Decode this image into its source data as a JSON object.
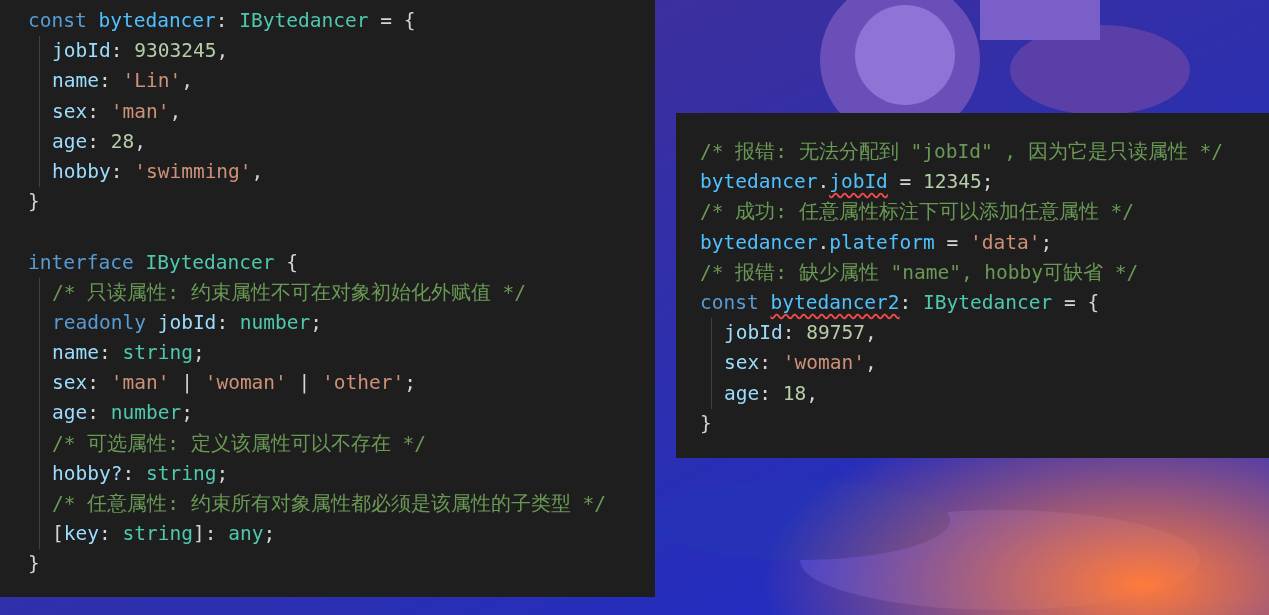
{
  "left_code": {
    "lines": [
      {
        "tokens": [
          {
            "text": "const",
            "kind": "keyword"
          },
          {
            "text": " bytedancer",
            "kind": "variable"
          },
          {
            "text": ": ",
            "kind": "punct"
          },
          {
            "text": "IBytedancer",
            "kind": "type"
          },
          {
            "text": " = {",
            "kind": "punct"
          }
        ],
        "children": [
          {
            "tokens": [
              {
                "text": "jobId",
                "kind": "property"
              },
              {
                "text": ": ",
                "kind": "punct"
              },
              {
                "text": "9303245",
                "kind": "number"
              },
              {
                "text": ",",
                "kind": "punct"
              }
            ]
          },
          {
            "tokens": [
              {
                "text": "name",
                "kind": "property"
              },
              {
                "text": ": ",
                "kind": "punct"
              },
              {
                "text": "'Lin'",
                "kind": "string"
              },
              {
                "text": ",",
                "kind": "punct"
              }
            ]
          },
          {
            "tokens": [
              {
                "text": "sex",
                "kind": "property"
              },
              {
                "text": ": ",
                "kind": "punct"
              },
              {
                "text": "'man'",
                "kind": "string"
              },
              {
                "text": ",",
                "kind": "punct"
              }
            ]
          },
          {
            "tokens": [
              {
                "text": "age",
                "kind": "property"
              },
              {
                "text": ": ",
                "kind": "punct"
              },
              {
                "text": "28",
                "kind": "number"
              },
              {
                "text": ",",
                "kind": "punct"
              }
            ]
          },
          {
            "tokens": [
              {
                "text": "hobby",
                "kind": "property"
              },
              {
                "text": ": ",
                "kind": "punct"
              },
              {
                "text": "'swimming'",
                "kind": "string"
              },
              {
                "text": ",",
                "kind": "punct"
              }
            ]
          }
        ]
      },
      {
        "tokens": [
          {
            "text": "}",
            "kind": "punct"
          }
        ]
      },
      {
        "gap_before": true,
        "tokens": [
          {
            "text": "interface",
            "kind": "keyword"
          },
          {
            "text": " IBytedancer",
            "kind": "type"
          },
          {
            "text": " {",
            "kind": "punct"
          }
        ],
        "children": [
          {
            "tokens": [
              {
                "text": "/* 只读属性: 约束属性不可在对象初始化外赋值 */",
                "kind": "comment"
              }
            ]
          },
          {
            "tokens": [
              {
                "text": "readonly",
                "kind": "keyword"
              },
              {
                "text": " jobId",
                "kind": "property"
              },
              {
                "text": ": ",
                "kind": "punct"
              },
              {
                "text": "number",
                "kind": "type"
              },
              {
                "text": ";",
                "kind": "punct"
              }
            ]
          },
          {
            "tokens": [
              {
                "text": "name",
                "kind": "property"
              },
              {
                "text": ": ",
                "kind": "punct"
              },
              {
                "text": "string",
                "kind": "type"
              },
              {
                "text": ";",
                "kind": "punct"
              }
            ]
          },
          {
            "tokens": [
              {
                "text": "sex",
                "kind": "property"
              },
              {
                "text": ": ",
                "kind": "punct"
              },
              {
                "text": "'man'",
                "kind": "string"
              },
              {
                "text": " | ",
                "kind": "punct"
              },
              {
                "text": "'woman'",
                "kind": "string"
              },
              {
                "text": " | ",
                "kind": "punct"
              },
              {
                "text": "'other'",
                "kind": "string"
              },
              {
                "text": ";",
                "kind": "punct"
              }
            ]
          },
          {
            "tokens": [
              {
                "text": "age",
                "kind": "property"
              },
              {
                "text": ": ",
                "kind": "punct"
              },
              {
                "text": "number",
                "kind": "type"
              },
              {
                "text": ";",
                "kind": "punct"
              }
            ]
          },
          {
            "tokens": [
              {
                "text": "/* 可选属性: 定义该属性可以不存在 */",
                "kind": "comment"
              }
            ]
          },
          {
            "tokens": [
              {
                "text": "hobby?",
                "kind": "property"
              },
              {
                "text": ": ",
                "kind": "punct"
              },
              {
                "text": "string",
                "kind": "type"
              },
              {
                "text": ";",
                "kind": "punct"
              }
            ]
          },
          {
            "tokens": [
              {
                "text": "/* 任意属性: 约束所有对象属性都必须是该属性的子类型 */",
                "kind": "comment"
              }
            ]
          },
          {
            "tokens": [
              {
                "text": "[",
                "kind": "punct"
              },
              {
                "text": "key",
                "kind": "property"
              },
              {
                "text": ": ",
                "kind": "punct"
              },
              {
                "text": "string",
                "kind": "type"
              },
              {
                "text": "]: ",
                "kind": "punct"
              },
              {
                "text": "any",
                "kind": "type"
              },
              {
                "text": ";",
                "kind": "punct"
              }
            ]
          }
        ]
      },
      {
        "tokens": [
          {
            "text": "}",
            "kind": "punct"
          }
        ]
      }
    ]
  },
  "right_code": {
    "lines": [
      {
        "tokens": [
          {
            "text": "/* 报错: 无法分配到 \"jobId\" , 因为它是只读属性 */",
            "kind": "comment"
          }
        ]
      },
      {
        "tokens": [
          {
            "text": "bytedancer",
            "kind": "variable"
          },
          {
            "text": ".",
            "kind": "punct"
          },
          {
            "text": "jobId",
            "kind": "variable",
            "error": true
          },
          {
            "text": " = ",
            "kind": "punct"
          },
          {
            "text": "12345",
            "kind": "number"
          },
          {
            "text": ";",
            "kind": "punct"
          }
        ]
      },
      {
        "tokens": [
          {
            "text": "/* 成功: 任意属性标注下可以添加任意属性 */",
            "kind": "comment"
          }
        ]
      },
      {
        "tokens": [
          {
            "text": "bytedancer",
            "kind": "variable"
          },
          {
            "text": ".",
            "kind": "punct"
          },
          {
            "text": "plateform",
            "kind": "variable"
          },
          {
            "text": " = ",
            "kind": "punct"
          },
          {
            "text": "'data'",
            "kind": "string"
          },
          {
            "text": ";",
            "kind": "punct"
          }
        ]
      },
      {
        "tokens": [
          {
            "text": "/* 报错: 缺少属性 \"name\", hobby可缺省 */",
            "kind": "comment"
          }
        ]
      },
      {
        "tokens": [
          {
            "text": "const ",
            "kind": "keyword"
          },
          {
            "text": "bytedancer2",
            "kind": "variable",
            "error": true
          },
          {
            "text": ": ",
            "kind": "punct"
          },
          {
            "text": "IBytedancer",
            "kind": "type"
          },
          {
            "text": " = {",
            "kind": "punct"
          }
        ],
        "children": [
          {
            "tokens": [
              {
                "text": "jobId",
                "kind": "property"
              },
              {
                "text": ": ",
                "kind": "punct"
              },
              {
                "text": "89757",
                "kind": "number"
              },
              {
                "text": ",",
                "kind": "punct"
              }
            ]
          },
          {
            "tokens": [
              {
                "text": "sex",
                "kind": "property"
              },
              {
                "text": ": ",
                "kind": "punct"
              },
              {
                "text": "'woman'",
                "kind": "string"
              },
              {
                "text": ",",
                "kind": "punct"
              }
            ]
          },
          {
            "tokens": [
              {
                "text": "age",
                "kind": "property"
              },
              {
                "text": ": ",
                "kind": "punct"
              },
              {
                "text": "18",
                "kind": "number"
              },
              {
                "text": ",",
                "kind": "punct"
              }
            ]
          }
        ]
      },
      {
        "tokens": [
          {
            "text": "}",
            "kind": "punct"
          }
        ]
      }
    ]
  }
}
